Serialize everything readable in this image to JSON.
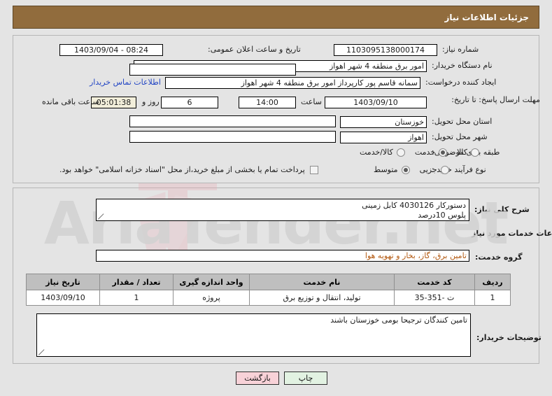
{
  "header": {
    "title": "جزئیات اطلاعات نیاز"
  },
  "form": {
    "labels": {
      "need_number": "شماره نیاز:",
      "buyer_org": "نام دستگاه خریدار:",
      "requester": "ایجاد کننده درخواست:",
      "response_deadline": "مهلت ارسال پاسخ: تا تاریخ:",
      "delivery_province": "استان محل تحویل:",
      "delivery_city": "شهر محل تحویل:",
      "subject_class": "طبقه بندی موضوعی:",
      "process_type": "نوع فرآیند خرید :",
      "public_announce_datetime": "تاریخ و ساعت اعلان عمومی:",
      "hour": "ساعت",
      "day_and": "روز و",
      "time_remaining": "ساعت باقی مانده"
    },
    "values": {
      "need_number": "1103095138000174",
      "buyer_org": "امور برق منطقه 4 شهر اهواز",
      "requester": "سمانه قاسم پور کارپرداز امور برق منطقه 4 شهر اهواز",
      "requester_secondary": "",
      "deadline_date": "1403/09/10",
      "deadline_time": "14:00",
      "days_left": "6",
      "timer": "05:01:38",
      "delivery_province": "خوزستان",
      "delivery_city": "اهواز",
      "public_announce_datetime": "1403/09/04 - 08:24"
    },
    "buyer_contact_link": "اطلاعات تماس خریدار",
    "subject_class_options": [
      {
        "label": "کالا",
        "selected": false
      },
      {
        "label": "خدمت",
        "selected": true
      },
      {
        "label": "کالا/خدمت",
        "selected": false
      }
    ],
    "process_type_options": [
      {
        "label": "جزیی",
        "selected": false
      },
      {
        "label": "متوسط",
        "selected": true
      }
    ],
    "treasury_checkbox": {
      "label": "پرداخت تمام یا بخشی از مبلغ خرید،از محل \"اسناد خزانه اسلامی\" خواهد بود.",
      "checked": false
    }
  },
  "need_description": {
    "label": "شرح کلی نیاز:",
    "value": "دستورکار 4030126 کابل زمینی\nپلوس 10درصد"
  },
  "services_section": {
    "heading": "اطلاعات خدمات مورد نیاز",
    "service_group_label": "گروه خدمت:",
    "service_group_value": "تامین برق، گاز، بخار و تهویه هوا",
    "table": {
      "columns": [
        "ردیف",
        "کد خدمت",
        "نام خدمت",
        "واحد اندازه گیری",
        "تعداد / مقدار",
        "تاریخ نیاز"
      ],
      "rows": [
        {
          "index": "1",
          "service_code": "ت -351-35",
          "service_name": "تولید، انتقال و توزیع برق",
          "unit": "پروژه",
          "quantity": "1",
          "need_date": "1403/09/10"
        }
      ]
    }
  },
  "buyer_notes": {
    "label": "توضیحات خریدار:",
    "value": "تامین کنندگان ترجیحا بومی خوزستان باشند"
  },
  "buttons": {
    "back": "بازگشت",
    "print": "چاپ"
  },
  "watermark": {
    "text": "AriaTender.net"
  },
  "colors": {
    "header_bg": "#916c3d",
    "page_bg": "#e4e4e4",
    "link": "#2245c4",
    "service_group_text": "#b35a12",
    "timer_bg": "#f2eeda",
    "back_btn": "#f8d2d8",
    "print_btn": "#e2f2e2",
    "table_header_bg": "#bfbfbf"
  }
}
